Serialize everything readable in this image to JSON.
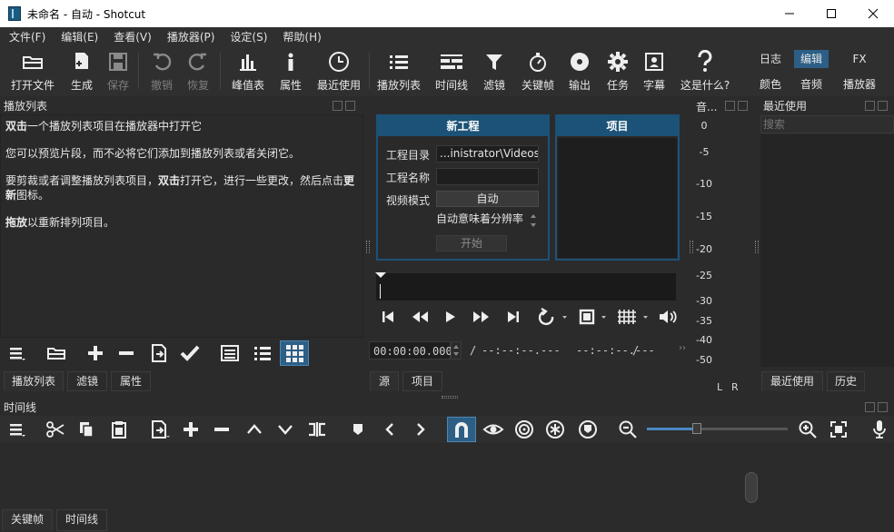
{
  "window": {
    "title": "未命名 - 自动 - Shotcut",
    "minimize": "—",
    "maximize": "☐",
    "close": "✕"
  },
  "menu": [
    "文件(F)",
    "编辑(E)",
    "查看(V)",
    "播放器(P)",
    "设定(S)",
    "帮助(H)"
  ],
  "toolbar": {
    "open": "打开文件",
    "generate": "生成",
    "save": "保存",
    "undo": "撤销",
    "redo": "恢复",
    "peak": "峰值表",
    "properties": "属性",
    "recent": "最近使用",
    "playlist": "播放列表",
    "timeline": "时间线",
    "filters": "滤镜",
    "keyframes": "关键帧",
    "export": "输出",
    "jobs": "任务",
    "subtitles": "字幕",
    "whatsthis": "这是什么?"
  },
  "layouts": {
    "log": "日志",
    "edit": "编辑",
    "fx": "FX",
    "color": "颜色",
    "audio": "音频",
    "player": "播放器"
  },
  "playlist": {
    "header": "播放列表",
    "line1_bold": "双击",
    "line1_rest": "一个播放列表项目在播放器中打开它",
    "line2": "您可以预览片段，而不必将它们添加到播放列表或者关闭它。",
    "line3_a": "要剪裁或者调整播放列表项目，",
    "line3_bold": "双击",
    "line3_b": "打开它，进行一些更改，然后点击",
    "line3_bold2": "更新",
    "line3_c": "图标。",
    "line4_bold": "拖放",
    "line4_rest": "以重新排列项目。",
    "tabs": [
      "播放列表",
      "滤镜",
      "属性"
    ]
  },
  "newproject": {
    "title": "新工程",
    "dir_label": "工程目录",
    "dir_value": "...inistrator\\Videos",
    "name_label": "工程名称",
    "name_value": "",
    "mode_label": "视频模式",
    "mode_value": "自动",
    "auto_hint": "自动意味着分辨率",
    "start": "开始",
    "projects_title": "项目"
  },
  "player": {
    "timecode": "00:00:00.000",
    "slash": "/",
    "duration": "--:--:--.---",
    "in_point": "--:--:--.---",
    "slash2": "/",
    "tabs": [
      "源",
      "项目"
    ]
  },
  "meter": {
    "title": "音...",
    "levels": [
      "0",
      "-5",
      "-10",
      "-15",
      "-20",
      "-25",
      "-30",
      "-35",
      "-40",
      "-50"
    ],
    "left": "L",
    "right": "R"
  },
  "recent": {
    "header": "最近使用",
    "search_placeholder": "搜索",
    "tabs": [
      "最近使用",
      "历史"
    ]
  },
  "timeline": {
    "header": "时间线",
    "tabs": [
      "关键帧",
      "时间线"
    ]
  },
  "colors": {
    "accent": "#2d5f86",
    "panel": "#2b2b2b",
    "snap": "#2d5f86"
  }
}
